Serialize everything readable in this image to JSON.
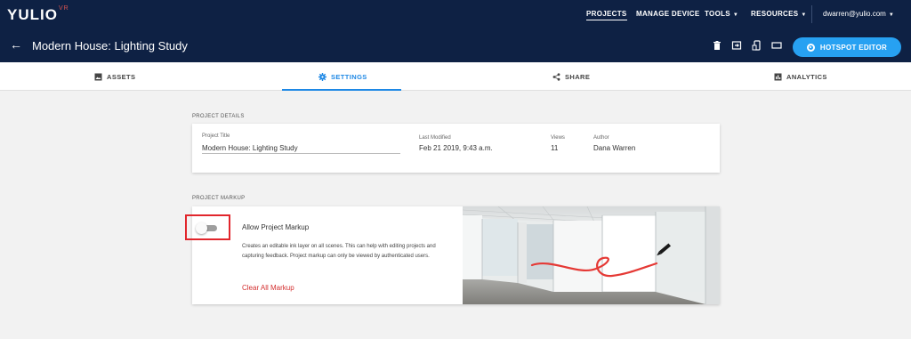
{
  "topbar": {
    "logo": "YULIO",
    "logo_sup": "VR",
    "nav": [
      {
        "label": "PROJECTS",
        "active": true
      },
      {
        "label": "MANAGE DEVICE"
      },
      {
        "label": "TOOLS"
      },
      {
        "label": "RESOURCES"
      }
    ],
    "user_email": "dwarren@yulio.com"
  },
  "header": {
    "project_title": "Modern House: Lighting Study",
    "hotspot_button": "HOTSPOT EDITOR",
    "icons": [
      "trash-icon",
      "export-icon",
      "device-icon",
      "screen-icon"
    ]
  },
  "tabs": [
    {
      "label": "ASSETS",
      "icon": "image-icon"
    },
    {
      "label": "SETTINGS",
      "icon": "gear-icon",
      "active": true
    },
    {
      "label": "SHARE",
      "icon": "share-icon"
    },
    {
      "label": "ANALYTICS",
      "icon": "analytics-icon"
    }
  ],
  "project_details": {
    "section_label": "PROJECT DETAILS",
    "title_label": "Project Title",
    "title_value": "Modern House: Lighting Study",
    "modified_label": "Last Modified",
    "modified_value": "Feb 21 2019, 9:43 a.m.",
    "views_label": "Views",
    "views_value": "11",
    "author_label": "Author",
    "author_value": "Dana Warren"
  },
  "project_markup": {
    "section_label": "PROJECT MARKUP",
    "toggle_label": "Allow Project Markup",
    "toggle_on": false,
    "description": "Creates an editable ink layer on all scenes. This can help with editing projects and capturing feedback. Project markup can only be viewed by authenticated users.",
    "clear_link": "Clear All Markup"
  },
  "colors": {
    "nav_bg": "#0e2144",
    "accent": "#27a1f2",
    "active_tab": "#1e88e5",
    "link_red": "#d32f2f",
    "highlight_box": "#e1262c"
  }
}
